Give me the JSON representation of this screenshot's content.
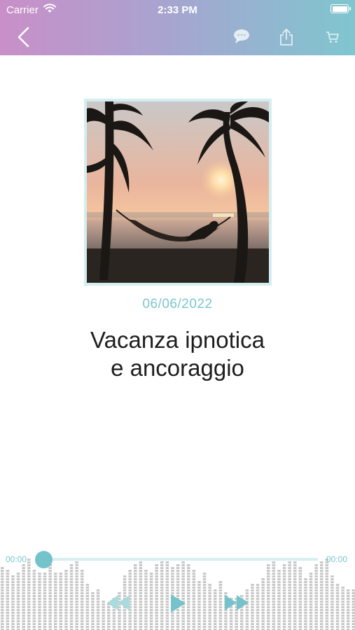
{
  "status_bar": {
    "carrier": "Carrier",
    "time": "2:33 PM"
  },
  "nav": {
    "back_icon": "chevron-left-icon",
    "actions": [
      "chat-bubble-icon",
      "share-icon",
      "cart-icon"
    ]
  },
  "episode": {
    "date": "06/06/2022",
    "title_line1": "Vacanza ipnotica",
    "title_line2": "e ancoraggio",
    "cover": "sunset-beach-hammock-palms-image"
  },
  "player": {
    "elapsed": "00:00",
    "remaining": "00:00",
    "progress": 0,
    "controls": [
      "rewind-icon",
      "play-icon",
      "fast-forward-icon"
    ]
  },
  "colors": {
    "accent": "#74c3cb",
    "header_gradient_start": "#c98fc8",
    "header_gradient_end": "#7fc6cf",
    "title_text": "#1e1e1e"
  }
}
